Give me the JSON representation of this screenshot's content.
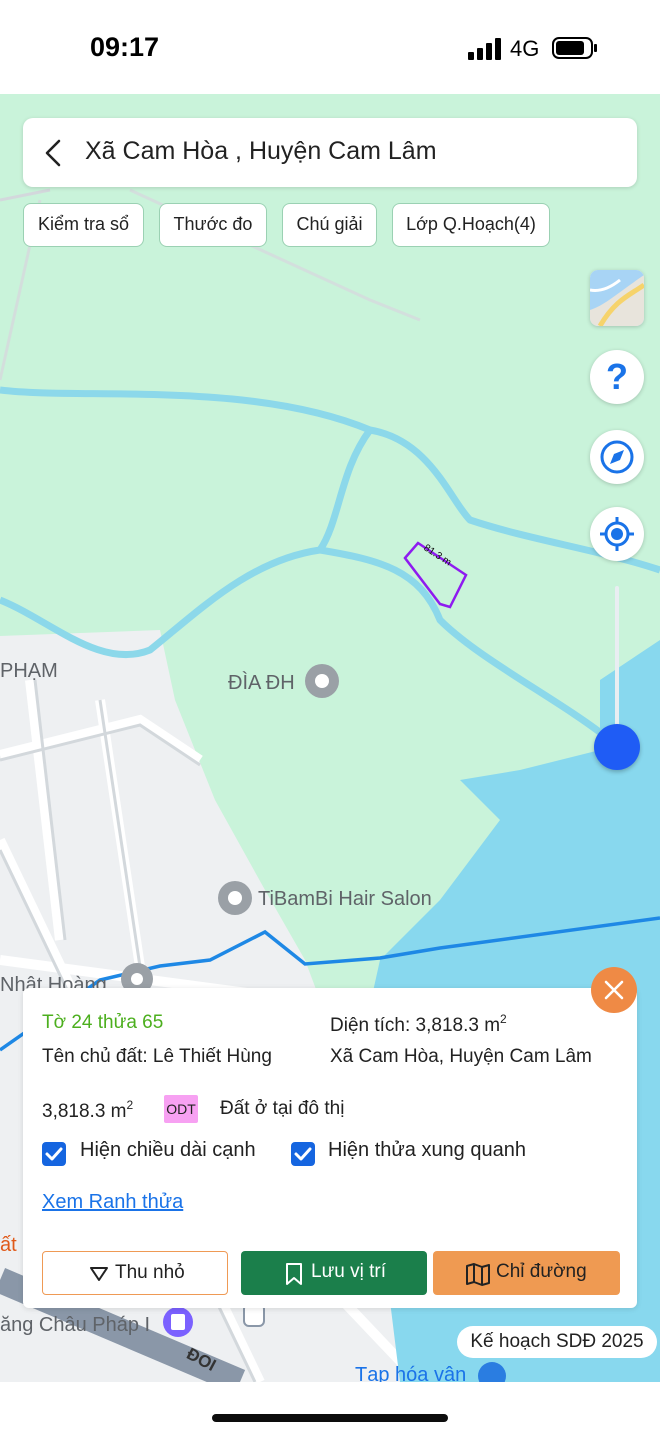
{
  "status_bar": {
    "time": "09:17",
    "network": "4G"
  },
  "search": {
    "location": "Xã Cam Hòa , Huyện Cam Lâm"
  },
  "chips": [
    {
      "label": "Kiểm tra sổ"
    },
    {
      "label": "Thước đo"
    },
    {
      "label": "Chú giải"
    },
    {
      "label": "Lớp Q.Hoạch(4)"
    }
  ],
  "map": {
    "labels": {
      "pham": "PHẠM",
      "dia_dh": "ĐÌA ĐH",
      "salon": "TiBamBi Hair Salon",
      "nhat_hoang": "Nhật Hoàng",
      "chau_phap": "ăng Châu Pháp I",
      "doi": "ĐOI",
      "tap_hoa": "Tạp hóa vân",
      "edge_at": "ất"
    },
    "parcel_edge_length": "81.3 m",
    "colors": {
      "land": "#c9f3da",
      "water": "#88d8ee",
      "river": "#8cd8ea",
      "road": "#e6e9ec",
      "parcel_outline": "#8e1bf0"
    }
  },
  "controls": {
    "help_icon": "question-icon",
    "compass_icon": "compass-icon",
    "locate_icon": "locate-icon",
    "zoom_level": 0.1
  },
  "panel": {
    "sheet_ref": "Tờ 24 thửa 65",
    "area_label": "Diện tích: 3,818.3 m",
    "area_sup": "2",
    "owner": "Tên chủ đất: Lê Thiết Hùng",
    "address": "Xã Cam Hòa, Huyện Cam Lâm",
    "land_area": "3,818.3 m",
    "land_area_sup": "2",
    "land_code": "ODT",
    "land_type": "Đất ở tại đô thị",
    "check_edge_length": "Hiện chiều dài cạnh",
    "check_edge_length_checked": true,
    "check_neighbors": "Hiện thửa xung quanh",
    "check_neighbors_checked": true,
    "view_boundary_link": "Xem Ranh thửa",
    "buttons": {
      "collapse": "Thu nhỏ",
      "save": "Lưu vị trí",
      "route": "Chỉ đường"
    }
  },
  "plan_tag": "Kế hoạch SDĐ 2025"
}
